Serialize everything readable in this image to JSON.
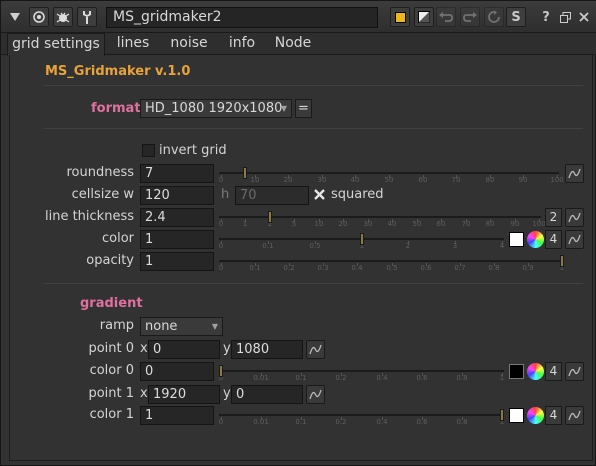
{
  "window": {
    "node_name": "MS_gridmaker2",
    "help_label": "?",
    "style": {
      "panel_bg": "#323232",
      "field_bg": "#262626",
      "title_orange": "#e8a33a",
      "title_pink": "#e070a0",
      "slider_handle": "#8a7a45"
    }
  },
  "icons": [
    "collapse-triangle-icon",
    "node-settings-icon",
    "bug-icon",
    "wrench-icon",
    "yellow-node-color-swatch",
    "gradient-swatch-icon",
    "undo-icon",
    "redo-icon",
    "revert-icon",
    "script-icon",
    "help-icon",
    "float-panel-icon",
    "close-icon"
  ],
  "tabs": [
    "grid settings",
    "lines",
    "noise",
    "info",
    "Node"
  ],
  "active_tab": "grid settings",
  "header_title": "MS_Gridmaker v.1.0",
  "format": {
    "label": "format",
    "value": "HD_1080 1920x1080",
    "eq_label": "="
  },
  "invert_grid": {
    "label": "invert grid",
    "checked": false
  },
  "roundness": {
    "label": "roundness",
    "value": "7",
    "ticks": [
      "0",
      "10",
      "20",
      "30",
      "40",
      "50",
      "60",
      "70",
      "80",
      "90",
      "100"
    ]
  },
  "cellsize": {
    "label": "cellsize w",
    "w": "120",
    "h_label": "h",
    "h": "70",
    "squared_label": "squared",
    "squared": true
  },
  "line_thickness": {
    "label": "line thickness",
    "value": "2.4",
    "ticks": [
      "0",
      "1",
      "2",
      "5",
      "10",
      "20",
      "30",
      "40",
      "50",
      "60",
      "70",
      "80",
      "90",
      "100"
    ],
    "channels": "2"
  },
  "color": {
    "label": "color",
    "value": "1",
    "ticks": [
      "0",
      "0.1",
      "0.5",
      "1",
      "2",
      "3",
      "4"
    ],
    "channels": "4",
    "swatch": "#ffffff"
  },
  "opacity": {
    "label": "opacity",
    "value": "1",
    "ticks": [
      "0",
      "0.1",
      "0.2",
      "0.3",
      "0.4",
      "0.5",
      "0.6",
      "0.7",
      "0.8",
      "0.9",
      "1"
    ]
  },
  "gradient": {
    "title": "gradient",
    "ramp": {
      "label": "ramp",
      "value": "none"
    },
    "point0": {
      "label": "point 0",
      "x_label": "x",
      "x": "0",
      "y_label": "y",
      "y": "1080"
    },
    "color0": {
      "label": "color 0",
      "value": "0",
      "ticks": [
        "0",
        "0.01",
        "0.1",
        "0.2",
        "0.4",
        "0.6",
        "0.8",
        "1"
      ],
      "channels": "4",
      "swatch": "#000000"
    },
    "point1": {
      "label": "point 1",
      "x_label": "x",
      "x": "1920",
      "y_label": "y",
      "y": "0"
    },
    "color1": {
      "label": "color 1",
      "value": "1",
      "ticks": [
        "0",
        "0.01",
        "0.1",
        "0.2",
        "0.4",
        "0.6",
        "0.8",
        "1"
      ],
      "channels": "4",
      "swatch": "#ffffff"
    }
  }
}
